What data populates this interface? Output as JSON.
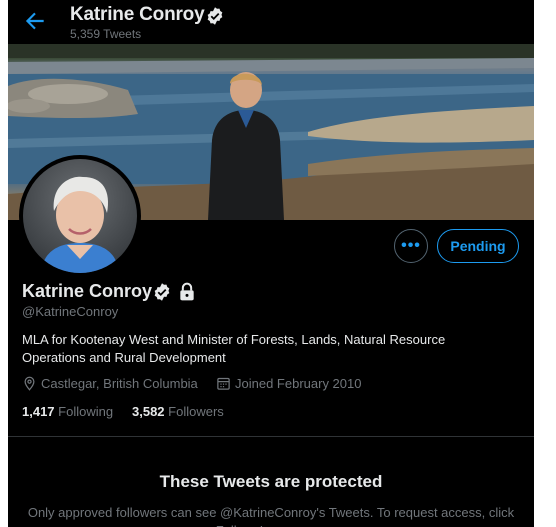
{
  "header": {
    "name": "Katrine Conroy",
    "tweet_count": "5,359 Tweets"
  },
  "profile": {
    "name": "Katrine Conroy",
    "handle": "@KatrineConroy",
    "bio": "MLA for Kootenay West and Minister of Forests, Lands, Natural Resource Operations and Rural Development",
    "location": "Castlegar, British Columbia",
    "joined": "Joined February 2010",
    "following_count": "1,417",
    "following_label": "Following",
    "followers_count": "3,582",
    "followers_label": "Followers"
  },
  "actions": {
    "more_label": "•••",
    "pending_label": "Pending"
  },
  "protected": {
    "title": "These Tweets are protected",
    "body": "Only approved followers can see @KatrineConroy's Tweets. To request access, click Follow. Learn more"
  },
  "icons": {
    "back": "back-arrow-icon",
    "verified": "verified-badge-icon",
    "lock": "lock-icon",
    "location": "location-pin-icon",
    "calendar": "calendar-icon"
  },
  "colors": {
    "accent": "#1d9bf0",
    "background": "#000000",
    "text_primary": "#e7e9ea",
    "text_secondary": "#71767b"
  }
}
